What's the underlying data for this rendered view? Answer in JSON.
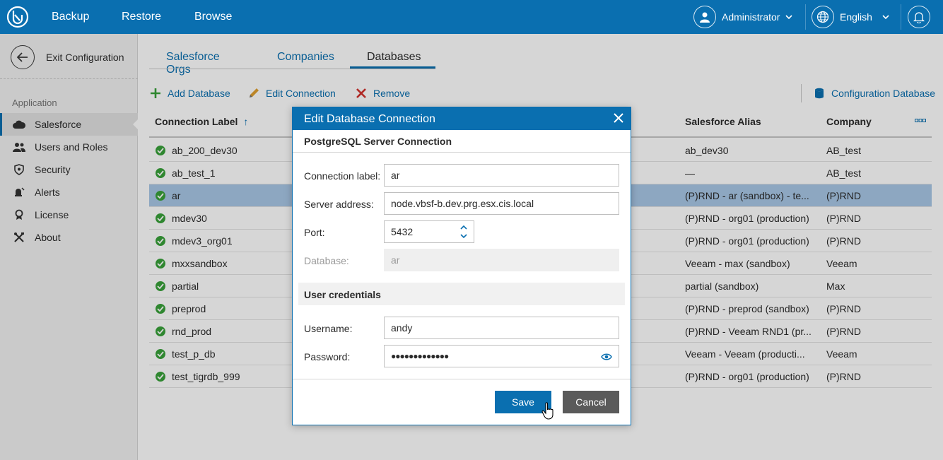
{
  "topbar": {
    "nav": [
      "Backup",
      "Restore",
      "Browse"
    ],
    "user": "Administrator",
    "language": "English",
    "color": "#0a6fb0"
  },
  "sidebar": {
    "exit_label": "Exit Configuration",
    "section": "Application",
    "items": [
      {
        "label": "Salesforce",
        "icon": "cloud-icon"
      },
      {
        "label": "Users and Roles",
        "icon": "users-icon"
      },
      {
        "label": "Security",
        "icon": "shield-icon"
      },
      {
        "label": "Alerts",
        "icon": "alert-icon"
      },
      {
        "label": "License",
        "icon": "license-icon"
      },
      {
        "label": "About",
        "icon": "tools-icon"
      }
    ]
  },
  "tabs": [
    "Salesforce Orgs",
    "Companies",
    "Databases"
  ],
  "toolbar": {
    "add": "Add Database",
    "edit": "Edit Connection",
    "remove": "Remove",
    "config_db": "Configuration Database"
  },
  "grid": {
    "headers": {
      "label": "Connection Label",
      "sort_arrow": "↑",
      "alias": "Salesforce Alias",
      "company": "Company"
    },
    "rows": [
      {
        "label": "ab_200_dev30",
        "alias": "ab_dev30",
        "company": "AB_test"
      },
      {
        "label": "ab_test_1",
        "alias": "—",
        "company": "AB_test"
      },
      {
        "label": "ar",
        "alias": "(P)RND - ar (sandbox) - te...",
        "company": "(P)RND"
      },
      {
        "label": "mdev30",
        "alias": "(P)RND - org01 (production)",
        "company": "(P)RND"
      },
      {
        "label": "mdev3_org01",
        "alias": "(P)RND - org01 (production)",
        "company": "(P)RND"
      },
      {
        "label": "mxxsandbox",
        "alias": "Veeam - max (sandbox)",
        "company": "Veeam"
      },
      {
        "label": "partial",
        "alias": "partial (sandbox)",
        "company": "Max"
      },
      {
        "label": "preprod",
        "alias": "(P)RND - preprod (sandbox)",
        "company": "(P)RND"
      },
      {
        "label": "rnd_prod",
        "alias": "(P)RND - Veeam RND1 (pr...",
        "company": "(P)RND"
      },
      {
        "label": "test_p_db",
        "alias": "Veeam - Veeam (producti...",
        "company": "Veeam"
      },
      {
        "label": "test_tigrdb_999",
        "alias": "(P)RND - org01 (production)",
        "company": "(P)RND"
      }
    ]
  },
  "dialog": {
    "title": "Edit Database Connection",
    "section1": "PostgreSQL Server Connection",
    "labels": {
      "connection_label": "Connection label:",
      "server": "Server address:",
      "port": "Port:",
      "database": "Database:",
      "username": "Username:",
      "password": "Password:"
    },
    "values": {
      "connection_label": "ar",
      "server": "node.vbsf-b.dev.prg.esx.cis.local",
      "port": "5432",
      "database": "ar",
      "username": "andy",
      "password": "●●●●●●●●●●●●●"
    },
    "section2": "User credentials",
    "save": "Save",
    "cancel": "Cancel"
  }
}
